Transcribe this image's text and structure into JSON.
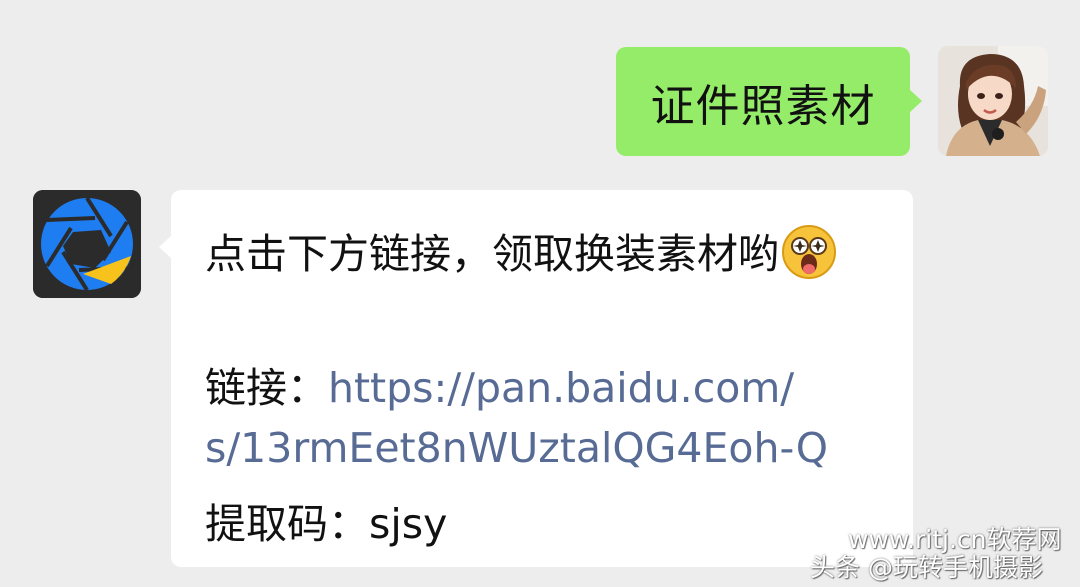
{
  "chat": {
    "outgoing": {
      "text": "证件照素材",
      "bubble_color": "#95ec69"
    },
    "incoming": {
      "line1": "点击下方链接，领取换装素材哟",
      "emoji": "star-struck-face",
      "link_label": "链接：",
      "link_part1": "https://pan.baidu.com/",
      "link_part2": "s/13rmEet8nWUztalQG4Eoh-Q",
      "code_label": "提取码：",
      "code_value": "sjsy",
      "link_color": "#576b95"
    }
  },
  "avatars": {
    "user": "user-avatar-photo",
    "bot": "camera-aperture-logo"
  },
  "watermarks": {
    "site": "www.ritj.cn软荐网",
    "source": "头条 @玩转手机摄影"
  },
  "colors": {
    "background": "#ededed",
    "incoming_bubble": "#ffffff",
    "aperture_blue": "#1e7df0",
    "aperture_yellow": "#f6c21b"
  }
}
